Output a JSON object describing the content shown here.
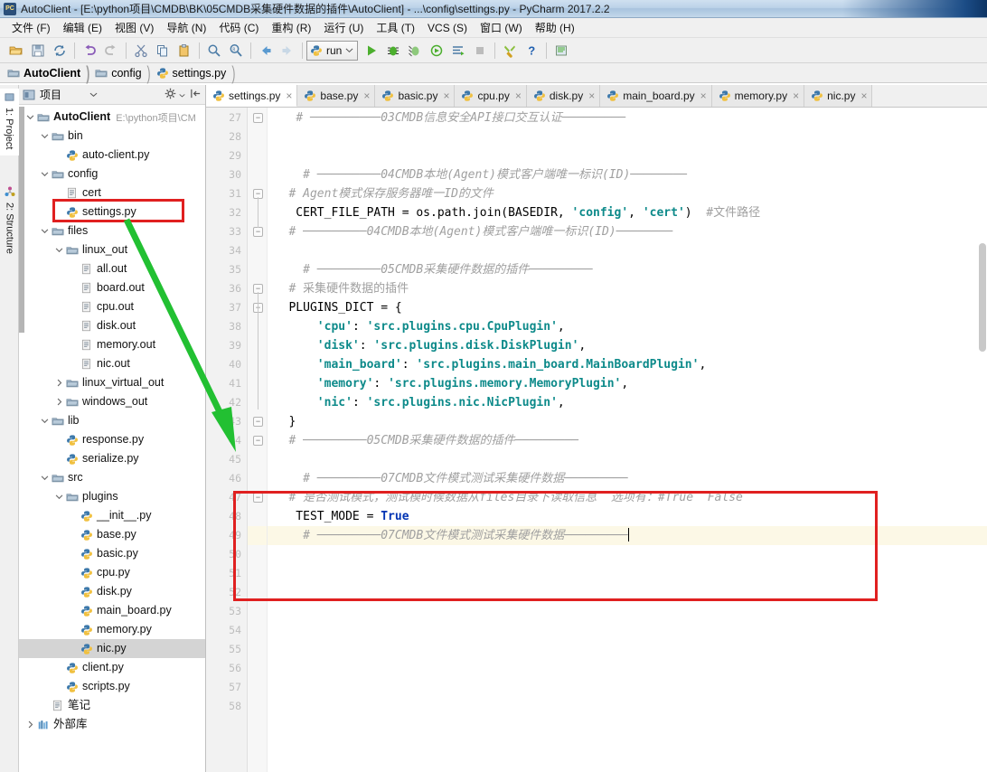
{
  "window": {
    "title": "AutoClient - [E:\\python项目\\CMDB\\BK\\05CMDB采集硬件数据的插件\\AutoClient] - ...\\config\\settings.py - PyCharm 2017.2.2",
    "app_icon": "pycharm-icon"
  },
  "menubar": {
    "items": [
      {
        "label": "文件 (F)"
      },
      {
        "label": "编辑 (E)"
      },
      {
        "label": "视图 (V)"
      },
      {
        "label": "导航 (N)"
      },
      {
        "label": "代码 (C)"
      },
      {
        "label": "重构 (R)"
      },
      {
        "label": "运行 (U)"
      },
      {
        "label": "工具 (T)"
      },
      {
        "label": "VCS (S)"
      },
      {
        "label": "窗口 (W)"
      },
      {
        "label": "帮助 (H)"
      }
    ]
  },
  "toolbar": {
    "run_config_label": "run",
    "buttons": [
      "open-folder-icon",
      "save-all-icon",
      "sync-icon",
      "undo-icon",
      "redo-icon",
      "cut-icon",
      "copy-icon",
      "paste-icon",
      "find-icon",
      "find-replace-icon",
      "back-icon",
      "forward-icon"
    ],
    "run_buttons": [
      "run-icon",
      "debug-icon",
      "coverage-icon",
      "profile-icon",
      "run-with-console-icon",
      "stop-icon"
    ],
    "right_buttons": [
      "settings-wrench-icon",
      "help-icon",
      "plugin-icon"
    ]
  },
  "breadcrumb": {
    "items": [
      {
        "label": "AutoClient",
        "icon": "folder-icon",
        "bold": true
      },
      {
        "label": "config",
        "icon": "folder-icon",
        "bold": false
      },
      {
        "label": "settings.py",
        "icon": "python-file-icon",
        "bold": false
      }
    ]
  },
  "left_strip": {
    "tabs": [
      {
        "label": "1: Project",
        "icon": "project-icon",
        "active": true
      },
      {
        "label": "2: Structure",
        "icon": "structure-icon",
        "active": false
      }
    ]
  },
  "project_panel": {
    "title": "项目",
    "header_icons": [
      "project-view-icon",
      "chevron-down-icon",
      "gear-icon",
      "collapse-icon"
    ],
    "tree": [
      {
        "indent": 0,
        "twisty": "down",
        "icon": "folder-icon",
        "label": "AutoClient",
        "bold": true,
        "path": "E:\\python项目\\CM"
      },
      {
        "indent": 1,
        "twisty": "down",
        "icon": "folder-icon",
        "label": "bin"
      },
      {
        "indent": 2,
        "twisty": "none",
        "icon": "python-file-icon",
        "label": "auto-client.py"
      },
      {
        "indent": 1,
        "twisty": "down",
        "icon": "folder-icon",
        "label": "config"
      },
      {
        "indent": 2,
        "twisty": "none",
        "icon": "text-file-icon",
        "label": "cert"
      },
      {
        "indent": 2,
        "twisty": "none",
        "icon": "python-file-icon",
        "label": "settings.py",
        "highlighted": true
      },
      {
        "indent": 1,
        "twisty": "down",
        "icon": "folder-icon",
        "label": "files"
      },
      {
        "indent": 2,
        "twisty": "down",
        "icon": "folder-icon",
        "label": "linux_out"
      },
      {
        "indent": 3,
        "twisty": "none",
        "icon": "text-file-icon",
        "label": "all.out"
      },
      {
        "indent": 3,
        "twisty": "none",
        "icon": "text-file-icon",
        "label": "board.out"
      },
      {
        "indent": 3,
        "twisty": "none",
        "icon": "text-file-icon",
        "label": "cpu.out"
      },
      {
        "indent": 3,
        "twisty": "none",
        "icon": "text-file-icon",
        "label": "disk.out"
      },
      {
        "indent": 3,
        "twisty": "none",
        "icon": "text-file-icon",
        "label": "memory.out"
      },
      {
        "indent": 3,
        "twisty": "none",
        "icon": "text-file-icon",
        "label": "nic.out"
      },
      {
        "indent": 2,
        "twisty": "right",
        "icon": "folder-icon",
        "label": "linux_virtual_out"
      },
      {
        "indent": 2,
        "twisty": "right",
        "icon": "folder-icon",
        "label": "windows_out"
      },
      {
        "indent": 1,
        "twisty": "down",
        "icon": "folder-icon",
        "label": "lib"
      },
      {
        "indent": 2,
        "twisty": "none",
        "icon": "python-file-icon",
        "label": "response.py"
      },
      {
        "indent": 2,
        "twisty": "none",
        "icon": "python-file-icon",
        "label": "serialize.py"
      },
      {
        "indent": 1,
        "twisty": "down",
        "icon": "folder-icon",
        "label": "src"
      },
      {
        "indent": 2,
        "twisty": "down",
        "icon": "folder-icon",
        "label": "plugins"
      },
      {
        "indent": 3,
        "twisty": "none",
        "icon": "python-file-icon",
        "label": "__init__.py"
      },
      {
        "indent": 3,
        "twisty": "none",
        "icon": "python-file-icon",
        "label": "base.py"
      },
      {
        "indent": 3,
        "twisty": "none",
        "icon": "python-file-icon",
        "label": "basic.py"
      },
      {
        "indent": 3,
        "twisty": "none",
        "icon": "python-file-icon",
        "label": "cpu.py"
      },
      {
        "indent": 3,
        "twisty": "none",
        "icon": "python-file-icon",
        "label": "disk.py"
      },
      {
        "indent": 3,
        "twisty": "none",
        "icon": "python-file-icon",
        "label": "main_board.py"
      },
      {
        "indent": 3,
        "twisty": "none",
        "icon": "python-file-icon",
        "label": "memory.py"
      },
      {
        "indent": 3,
        "twisty": "none",
        "icon": "python-file-icon",
        "label": "nic.py",
        "selected": true
      },
      {
        "indent": 2,
        "twisty": "none",
        "icon": "python-file-icon",
        "label": "client.py"
      },
      {
        "indent": 2,
        "twisty": "none",
        "icon": "python-file-icon",
        "label": "scripts.py"
      },
      {
        "indent": 1,
        "twisty": "none",
        "icon": "text-file-icon",
        "label": "笔记"
      },
      {
        "indent": 0,
        "twisty": "right",
        "icon": "library-icon",
        "label": "外部库"
      }
    ]
  },
  "editor": {
    "tabs": [
      {
        "label": "settings.py",
        "active": true
      },
      {
        "label": "base.py",
        "active": false
      },
      {
        "label": "basic.py",
        "active": false
      },
      {
        "label": "cpu.py",
        "active": false
      },
      {
        "label": "disk.py",
        "active": false
      },
      {
        "label": "main_board.py",
        "active": false
      },
      {
        "label": "memory.py",
        "active": false
      },
      {
        "label": "nic.py",
        "active": false
      }
    ],
    "first_line_number": 27,
    "highlight_line": 49,
    "lines": [
      {
        "n": 27,
        "fold": "collapse",
        "segments": [
          {
            "t": "    ",
            "c": "id"
          },
          {
            "t": "# ──────────03CMDB信息安全API接口交互认证─────────",
            "c": "cm"
          }
        ]
      },
      {
        "n": 28,
        "segments": []
      },
      {
        "n": 29,
        "segments": []
      },
      {
        "n": 30,
        "segments": [
          {
            "t": "     ",
            "c": "id"
          },
          {
            "t": "# ─────────04CMDB本地(Agent)模式客户端唯一标识(ID)────────",
            "c": "cm"
          }
        ]
      },
      {
        "n": 31,
        "fold": "collapse",
        "segments": [
          {
            "t": "   ",
            "c": "id"
          },
          {
            "t": "# Agent模式保存服务器唯一ID的文件",
            "c": "cm"
          }
        ]
      },
      {
        "n": 32,
        "segments": [
          {
            "t": "    CERT_FILE_PATH = os.path.join(BASEDIR, ",
            "c": "id"
          },
          {
            "t": "'config'",
            "c": "str"
          },
          {
            "t": ", ",
            "c": "id"
          },
          {
            "t": "'cert'",
            "c": "str"
          },
          {
            "t": ")  ",
            "c": "id"
          },
          {
            "t": "#文件路径",
            "c": "cm-plain"
          }
        ]
      },
      {
        "n": 33,
        "fold": "collapse",
        "segments": [
          {
            "t": "   ",
            "c": "id"
          },
          {
            "t": "# ─────────04CMDB本地(Agent)模式客户端唯一标识(ID)────────",
            "c": "cm"
          }
        ]
      },
      {
        "n": 34,
        "segments": []
      },
      {
        "n": 35,
        "segments": [
          {
            "t": "     ",
            "c": "id"
          },
          {
            "t": "# ─────────05CMDB采集硬件数据的插件─────────",
            "c": "cm"
          }
        ]
      },
      {
        "n": 36,
        "fold": "collapse",
        "segments": [
          {
            "t": "   ",
            "c": "id"
          },
          {
            "t": "# 采集硬件数据的插件",
            "c": "cm-plain"
          }
        ]
      },
      {
        "n": 37,
        "fold": "collapse",
        "segments": [
          {
            "t": "   PLUGINS_DICT = {",
            "c": "id"
          }
        ]
      },
      {
        "n": 38,
        "segments": [
          {
            "t": "       ",
            "c": "id"
          },
          {
            "t": "'cpu'",
            "c": "str"
          },
          {
            "t": ": ",
            "c": "id"
          },
          {
            "t": "'src.plugins.cpu.CpuPlugin'",
            "c": "str"
          },
          {
            "t": ",",
            "c": "id"
          }
        ]
      },
      {
        "n": 39,
        "segments": [
          {
            "t": "       ",
            "c": "id"
          },
          {
            "t": "'disk'",
            "c": "str"
          },
          {
            "t": ": ",
            "c": "id"
          },
          {
            "t": "'src.plugins.disk.DiskPlugin'",
            "c": "str"
          },
          {
            "t": ",",
            "c": "id"
          }
        ]
      },
      {
        "n": 40,
        "segments": [
          {
            "t": "       ",
            "c": "id"
          },
          {
            "t": "'main_board'",
            "c": "str"
          },
          {
            "t": ": ",
            "c": "id"
          },
          {
            "t": "'src.plugins.main_board.MainBoardPlugin'",
            "c": "str"
          },
          {
            "t": ",",
            "c": "id"
          }
        ]
      },
      {
        "n": 41,
        "segments": [
          {
            "t": "       ",
            "c": "id"
          },
          {
            "t": "'memory'",
            "c": "str"
          },
          {
            "t": ": ",
            "c": "id"
          },
          {
            "t": "'src.plugins.memory.MemoryPlugin'",
            "c": "str"
          },
          {
            "t": ",",
            "c": "id"
          }
        ]
      },
      {
        "n": 42,
        "segments": [
          {
            "t": "       ",
            "c": "id"
          },
          {
            "t": "'nic'",
            "c": "str"
          },
          {
            "t": ": ",
            "c": "id"
          },
          {
            "t": "'src.plugins.nic.NicPlugin'",
            "c": "str"
          },
          {
            "t": ",",
            "c": "id"
          }
        ]
      },
      {
        "n": 43,
        "fold": "collapse",
        "segments": [
          {
            "t": "   }",
            "c": "id"
          }
        ]
      },
      {
        "n": 44,
        "fold": "collapse",
        "segments": [
          {
            "t": "   ",
            "c": "id"
          },
          {
            "t": "# ─────────05CMDB采集硬件数据的插件─────────",
            "c": "cm"
          }
        ]
      },
      {
        "n": 45,
        "segments": []
      },
      {
        "n": 46,
        "segments": [
          {
            "t": "     ",
            "c": "id"
          },
          {
            "t": "# ─────────07CMDB文件模式测试采集硬件数据─────────",
            "c": "cm"
          }
        ]
      },
      {
        "n": 47,
        "fold": "collapse",
        "segments": [
          {
            "t": "   ",
            "c": "id"
          },
          {
            "t": "# 是否测试模式，测试模时候数据从files目录下读取信息  选项有：#True  False",
            "c": "cm"
          }
        ]
      },
      {
        "n": 48,
        "segments": [
          {
            "t": "    TEST_MODE = ",
            "c": "id"
          },
          {
            "t": "True",
            "c": "kw"
          }
        ]
      },
      {
        "n": 49,
        "highlight": true,
        "caret": true,
        "segments": [
          {
            "t": "     ",
            "c": "id"
          },
          {
            "t": "# ─────────07CMDB文件模式测试采集硬件数据─────────",
            "c": "cm"
          }
        ]
      },
      {
        "n": 50,
        "segments": []
      },
      {
        "n": 51,
        "segments": []
      },
      {
        "n": 52,
        "segments": []
      },
      {
        "n": 53,
        "segments": []
      },
      {
        "n": 54,
        "segments": []
      },
      {
        "n": 55,
        "segments": []
      },
      {
        "n": 56,
        "segments": []
      },
      {
        "n": 57,
        "segments": []
      },
      {
        "n": 58,
        "segments": []
      }
    ]
  },
  "annotations": {
    "red_box_sidebar": {
      "name": "settings-py-highlight-box",
      "color": "#e02020"
    },
    "red_box_editor": {
      "name": "test-mode-highlight-box",
      "color": "#e02020"
    },
    "green_arrow": {
      "name": "pointer-arrow",
      "color": "#22c032"
    }
  },
  "colors": {
    "accent": "#0033b3",
    "string": "#0d8a8a",
    "comment": "#a0a0a0",
    "highlight_row": "#fcf8e6",
    "selection": "#d4d4d4",
    "annotation_red": "#e02020",
    "annotation_green": "#22c032"
  }
}
